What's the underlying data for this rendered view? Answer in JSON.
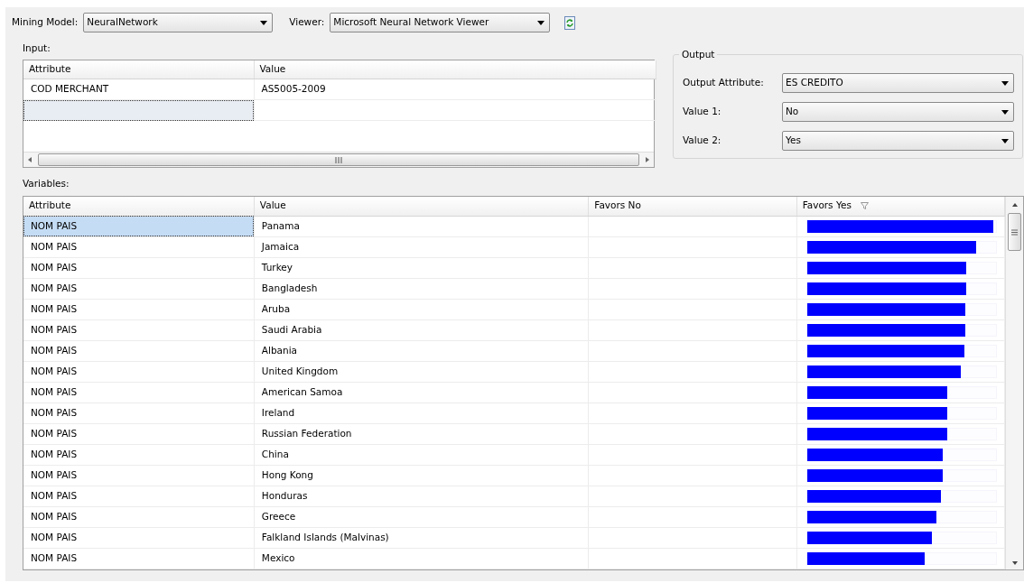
{
  "toolbar": {
    "model_label": "Mining Model:",
    "model": "NeuralNetwork",
    "viewer_label": "Viewer:",
    "viewer": "Microsoft Neural Network Viewer"
  },
  "input": {
    "label": "Input:",
    "columns": [
      "Attribute",
      "Value"
    ],
    "rows": [
      {
        "attribute": "COD MERCHANT",
        "value": "AS5005-2009",
        "selected": false
      },
      {
        "attribute": "",
        "value": "",
        "selected": true
      }
    ]
  },
  "output": {
    "title": "Output",
    "fields": [
      {
        "label": "Output Attribute:",
        "value": "ES CREDITO"
      },
      {
        "label": "Value 1:",
        "value": "No"
      },
      {
        "label": "Value 2:",
        "value": "Yes"
      }
    ]
  },
  "variables": {
    "label": "Variables:",
    "columns": [
      "Attribute",
      "Value",
      "Favors No",
      "Favors Yes"
    ],
    "rows": [
      {
        "attribute": "NOM PAIS",
        "value": "Panama",
        "selected": true,
        "favors_yes": {
          "level": 0.98
        }
      },
      {
        "attribute": "NOM PAIS",
        "value": "Jamaica",
        "selected": false,
        "favors_yes": {
          "level": 0.89
        }
      },
      {
        "attribute": "NOM PAIS",
        "value": "Turkey",
        "selected": false,
        "favors_yes": {
          "level": 0.84
        }
      },
      {
        "attribute": "NOM PAIS",
        "value": "Bangladesh",
        "selected": false,
        "favors_yes": {
          "level": 0.84
        }
      },
      {
        "attribute": "NOM PAIS",
        "value": "Aruba",
        "selected": false,
        "favors_yes": {
          "level": 0.835
        }
      },
      {
        "attribute": "NOM PAIS",
        "value": "Saudi Arabia",
        "selected": false,
        "favors_yes": {
          "level": 0.835
        }
      },
      {
        "attribute": "NOM PAIS",
        "value": "Albania",
        "selected": false,
        "favors_yes": {
          "level": 0.83
        }
      },
      {
        "attribute": "NOM PAIS",
        "value": "United Kingdom",
        "selected": false,
        "favors_yes": {
          "level": 0.81
        }
      },
      {
        "attribute": "NOM PAIS",
        "value": "American Samoa",
        "selected": false,
        "favors_yes": {
          "level": 0.74
        }
      },
      {
        "attribute": "NOM PAIS",
        "value": "Ireland",
        "selected": false,
        "favors_yes": {
          "level": 0.74
        }
      },
      {
        "attribute": "NOM PAIS",
        "value": "Russian Federation",
        "selected": false,
        "favors_yes": {
          "level": 0.74
        }
      },
      {
        "attribute": "NOM PAIS",
        "value": "China",
        "selected": false,
        "favors_yes": {
          "level": 0.715
        }
      },
      {
        "attribute": "NOM PAIS",
        "value": "Hong Kong",
        "selected": false,
        "favors_yes": {
          "level": 0.715
        }
      },
      {
        "attribute": "NOM PAIS",
        "value": "Honduras",
        "selected": false,
        "favors_yes": {
          "level": 0.705
        }
      },
      {
        "attribute": "NOM PAIS",
        "value": "Greece",
        "selected": false,
        "favors_yes": {
          "level": 0.68
        }
      },
      {
        "attribute": "NOM PAIS",
        "value": "Falkland Islands (Malvinas)",
        "selected": false,
        "favors_yes": {
          "level": 0.66
        }
      },
      {
        "attribute": "NOM PAIS",
        "value": "Mexico",
        "selected": false,
        "favors_yes": {
          "level": 0.62
        }
      }
    ]
  }
}
